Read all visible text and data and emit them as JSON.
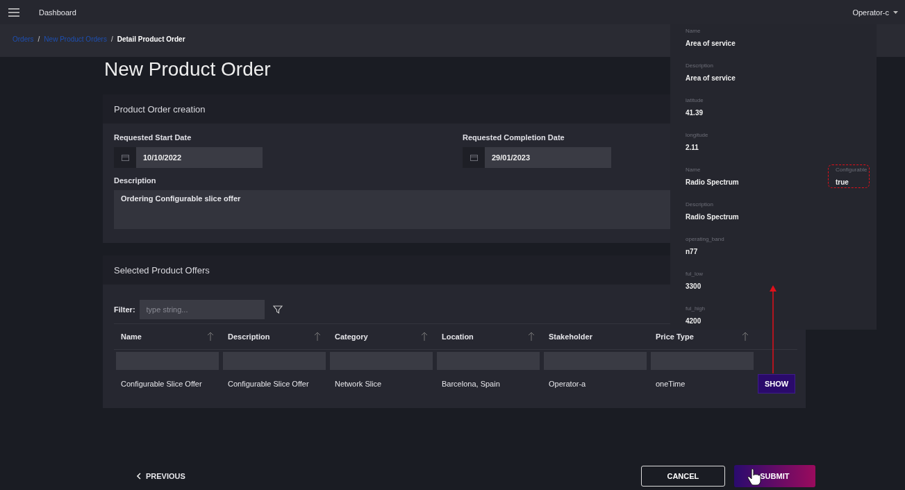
{
  "top_bar": {
    "title": "Dashboard",
    "user": "Operator-c"
  },
  "breadcrumb": [
    {
      "label": "Orders",
      "current": false
    },
    {
      "separator": "/",
      "label": "New Product Orders",
      "current": false
    },
    {
      "separator": "/",
      "label": "Detail Product Order",
      "current": true
    }
  ],
  "page_title": "New Product Order",
  "order_section": {
    "title": "Product Order creation",
    "start_label": "Requested Start Date",
    "start_value": "10/10/2022",
    "completion_label": "Requested Completion Date",
    "completion_value": "29/01/2023",
    "description_label": "Description",
    "description_value": "Ordering Configurable slice offer"
  },
  "offers_section": {
    "title": "Selected Product Offers",
    "filter_label": "Filter:",
    "filter_placeholder": "type string...",
    "columns": [
      {
        "label": "Name",
        "sortable": true
      },
      {
        "label": "Description",
        "sortable": true
      },
      {
        "label": "Category",
        "sortable": true
      },
      {
        "label": "Location",
        "sortable": true
      },
      {
        "label": "Stakeholder",
        "sortable": false
      },
      {
        "label": "Price Type",
        "sortable": true
      }
    ],
    "rows": [
      {
        "cells": [
          "Configurable Slice Offer",
          "Configurable Slice Offer",
          "Network Slice",
          "Barcelona, Spain",
          "Operator-a",
          "oneTime"
        ],
        "action": "SHOW"
      }
    ]
  },
  "footer": {
    "previous": "PREVIOUS",
    "cancel": "CANCEL",
    "submit": "SUBMIT"
  },
  "detail_popup": {
    "rows": [
      {
        "fields": [
          {
            "label": "Name",
            "value": "Area of service",
            "highlighted": false
          }
        ]
      },
      {
        "fields": [
          {
            "label": "Description",
            "value": "Area of service",
            "highlighted": false
          }
        ]
      },
      {
        "fields": [
          {
            "label": "latitude",
            "value": "41.39",
            "highlighted": false
          }
        ]
      },
      {
        "fields": [
          {
            "label": "longitude",
            "value": "2.11",
            "highlighted": false
          }
        ]
      },
      {
        "fields": [
          {
            "label": "Name",
            "value": "Radio Spectrum",
            "highlighted": false
          },
          {
            "label": "Configurable",
            "value": "true",
            "highlighted": true
          }
        ]
      },
      {
        "fields": [
          {
            "label": "Description",
            "value": "Radio Spectrum",
            "highlighted": false
          }
        ]
      },
      {
        "fields": [
          {
            "label": "operating_band",
            "value": "n77",
            "highlighted": false
          }
        ]
      },
      {
        "fields": [
          {
            "label": "ful_low",
            "value": "3300",
            "highlighted": false
          }
        ]
      },
      {
        "fields": [
          {
            "label": "ful_high",
            "value": "4200",
            "highlighted": false
          }
        ]
      }
    ]
  }
}
